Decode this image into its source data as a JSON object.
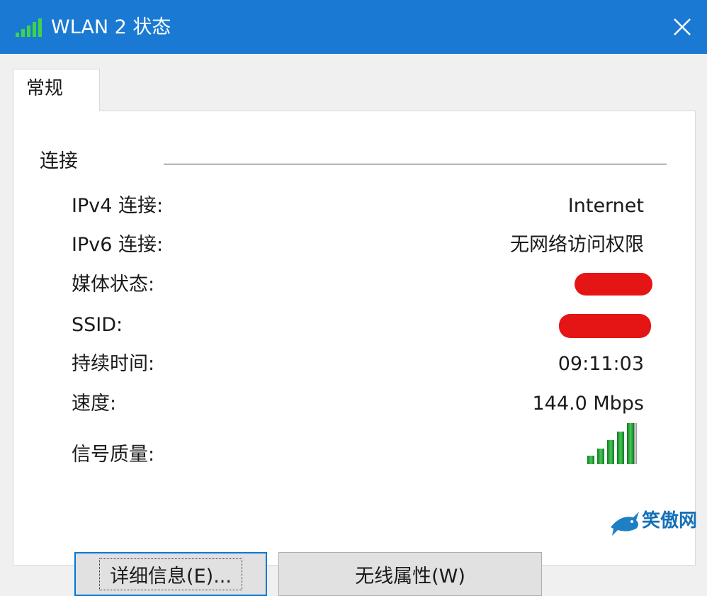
{
  "window": {
    "title": "WLAN 2 状态",
    "title_icon": "wifi-signal-icon",
    "close_icon": "close-icon"
  },
  "tabs": [
    {
      "label": "常规",
      "active": true
    }
  ],
  "connection": {
    "group_label": "连接",
    "rows": [
      {
        "label": "IPv4 连接:",
        "value": "Internet"
      },
      {
        "label": "IPv6 连接:",
        "value": "无网络访问权限"
      },
      {
        "label": "媒体状态:",
        "value": ""
      },
      {
        "label": "SSID:",
        "value": ""
      },
      {
        "label": "持续时间:",
        "value": "09:11:03"
      },
      {
        "label": "速度:",
        "value": "144.0 Mbps"
      },
      {
        "label": "信号质量:",
        "value": ""
      }
    ],
    "signal_quality_bars": 5,
    "signal_quality_max": 5,
    "signal_icon": "signal-bars-icon"
  },
  "buttons": {
    "details": "详细信息(E)...",
    "wireless_properties": "无线属性(W)"
  },
  "colors": {
    "titlebar": "#1a7ad3",
    "signal_green": "#1a9a2a",
    "redaction": "#e51515"
  },
  "watermark": {
    "text": "笑傲网"
  }
}
